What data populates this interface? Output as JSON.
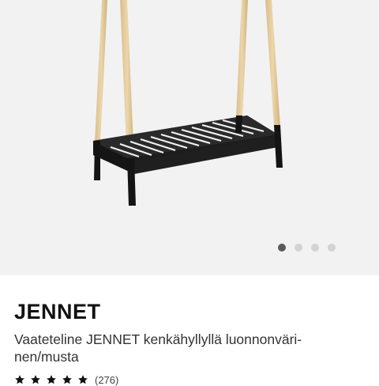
{
  "product": {
    "name": "JENNET",
    "description_line1": "Vaateteline JENNET kenkähyllyllä luonnonväri-",
    "description_line2": "nen/musta",
    "rating_count": "(276)",
    "rating_stars": 5
  },
  "gallery": {
    "image_count": 4,
    "active_index": 0
  },
  "colors": {
    "wood": "#e3c99a",
    "frame": "#1b1b1b",
    "background": "#f2f2f2",
    "dot_active": "#5a5a5a",
    "dot_inactive": "#d3d3d3"
  }
}
